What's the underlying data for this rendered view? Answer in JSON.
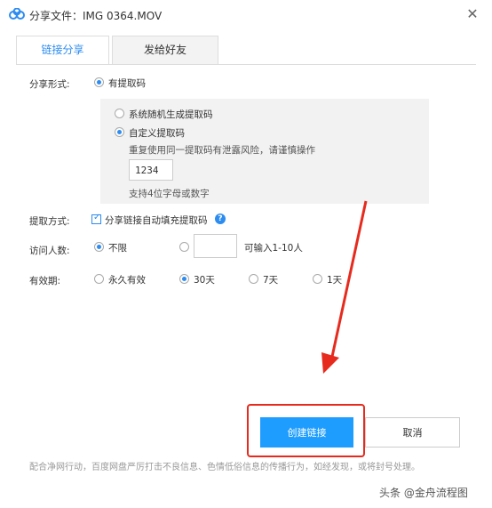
{
  "window": {
    "title": "分享文件：IMG 0364.MOV",
    "close_glyph": "✕"
  },
  "tabs": [
    {
      "label": "链接分享",
      "active": true
    },
    {
      "label": "发给好友",
      "active": false
    }
  ],
  "share_form": {
    "label": "分享形式:",
    "option_with_code": "有提取码",
    "option_random": "系统随机生成提取码",
    "option_custom": "自定义提取码",
    "warning": "重复使用同一提取码有泄露风险，请谨慎操作",
    "code_value": "1234",
    "hint": "支持4位字母或数字"
  },
  "extract": {
    "label": "提取方式:",
    "auto_fill": "分享链接自动填充提取码",
    "help_glyph": "?"
  },
  "visitors": {
    "label": "访问人数:",
    "unlimited": "不限",
    "custom_hint": "可输入1-10人",
    "custom_value": ""
  },
  "validity": {
    "label": "有效期:",
    "options": [
      "永久有效",
      "30天",
      "7天",
      "1天"
    ],
    "selected": "30天"
  },
  "buttons": {
    "create": "创建链接",
    "cancel": "取消"
  },
  "footer": "配合净网行动，百度网盘严厉打击不良信息、色情低俗信息的传播行为，如经发现，或将封号处理。",
  "watermark": "头条 @金舟流程图",
  "colors": {
    "accent": "#2d8cf0",
    "button": "#1e9dff",
    "annotation": "#e62b1e"
  }
}
